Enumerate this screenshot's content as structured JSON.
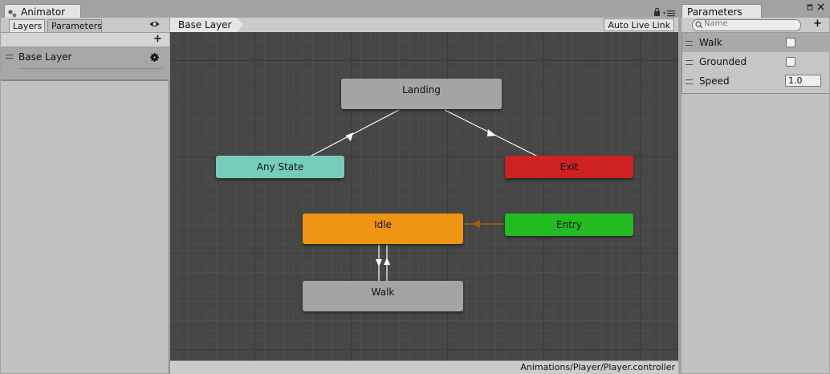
{
  "window": {
    "animator_tab": "Animator",
    "parameters_tab": "Parameters"
  },
  "left_panel": {
    "tabs": [
      {
        "label": "Layers",
        "active": true
      },
      {
        "label": "Parameters",
        "active": false
      }
    ],
    "layers": [
      {
        "name": "Base Layer"
      }
    ]
  },
  "graph": {
    "breadcrumb": "Base Layer",
    "auto_live_link": "Auto Live Link",
    "footer_path": "Animations/Player/Player.controller",
    "states": {
      "landing": "Landing",
      "any_state": "Any State",
      "exit": "Exit",
      "idle": "Idle",
      "entry": "Entry",
      "walk": "Walk"
    }
  },
  "parameters": {
    "search_placeholder": "Name",
    "items": [
      {
        "name": "Walk",
        "type": "bool",
        "value": false
      },
      {
        "name": "Grounded",
        "type": "bool",
        "value": false
      },
      {
        "name": "Speed",
        "type": "float",
        "value": "1.0"
      }
    ]
  },
  "colors": {
    "any_state": "#77ccbb",
    "exit": "#cc2222",
    "idle": "#f09414",
    "entry": "#22bb22",
    "default_state": "#a4a4a4",
    "graph_bg": "#464646"
  },
  "icons": [
    "lock-icon",
    "menu-icon",
    "close-icon",
    "maximize-icon",
    "eye-icon",
    "plus-icon",
    "gear-icon",
    "search-icon",
    "drag-handle-icon"
  ]
}
